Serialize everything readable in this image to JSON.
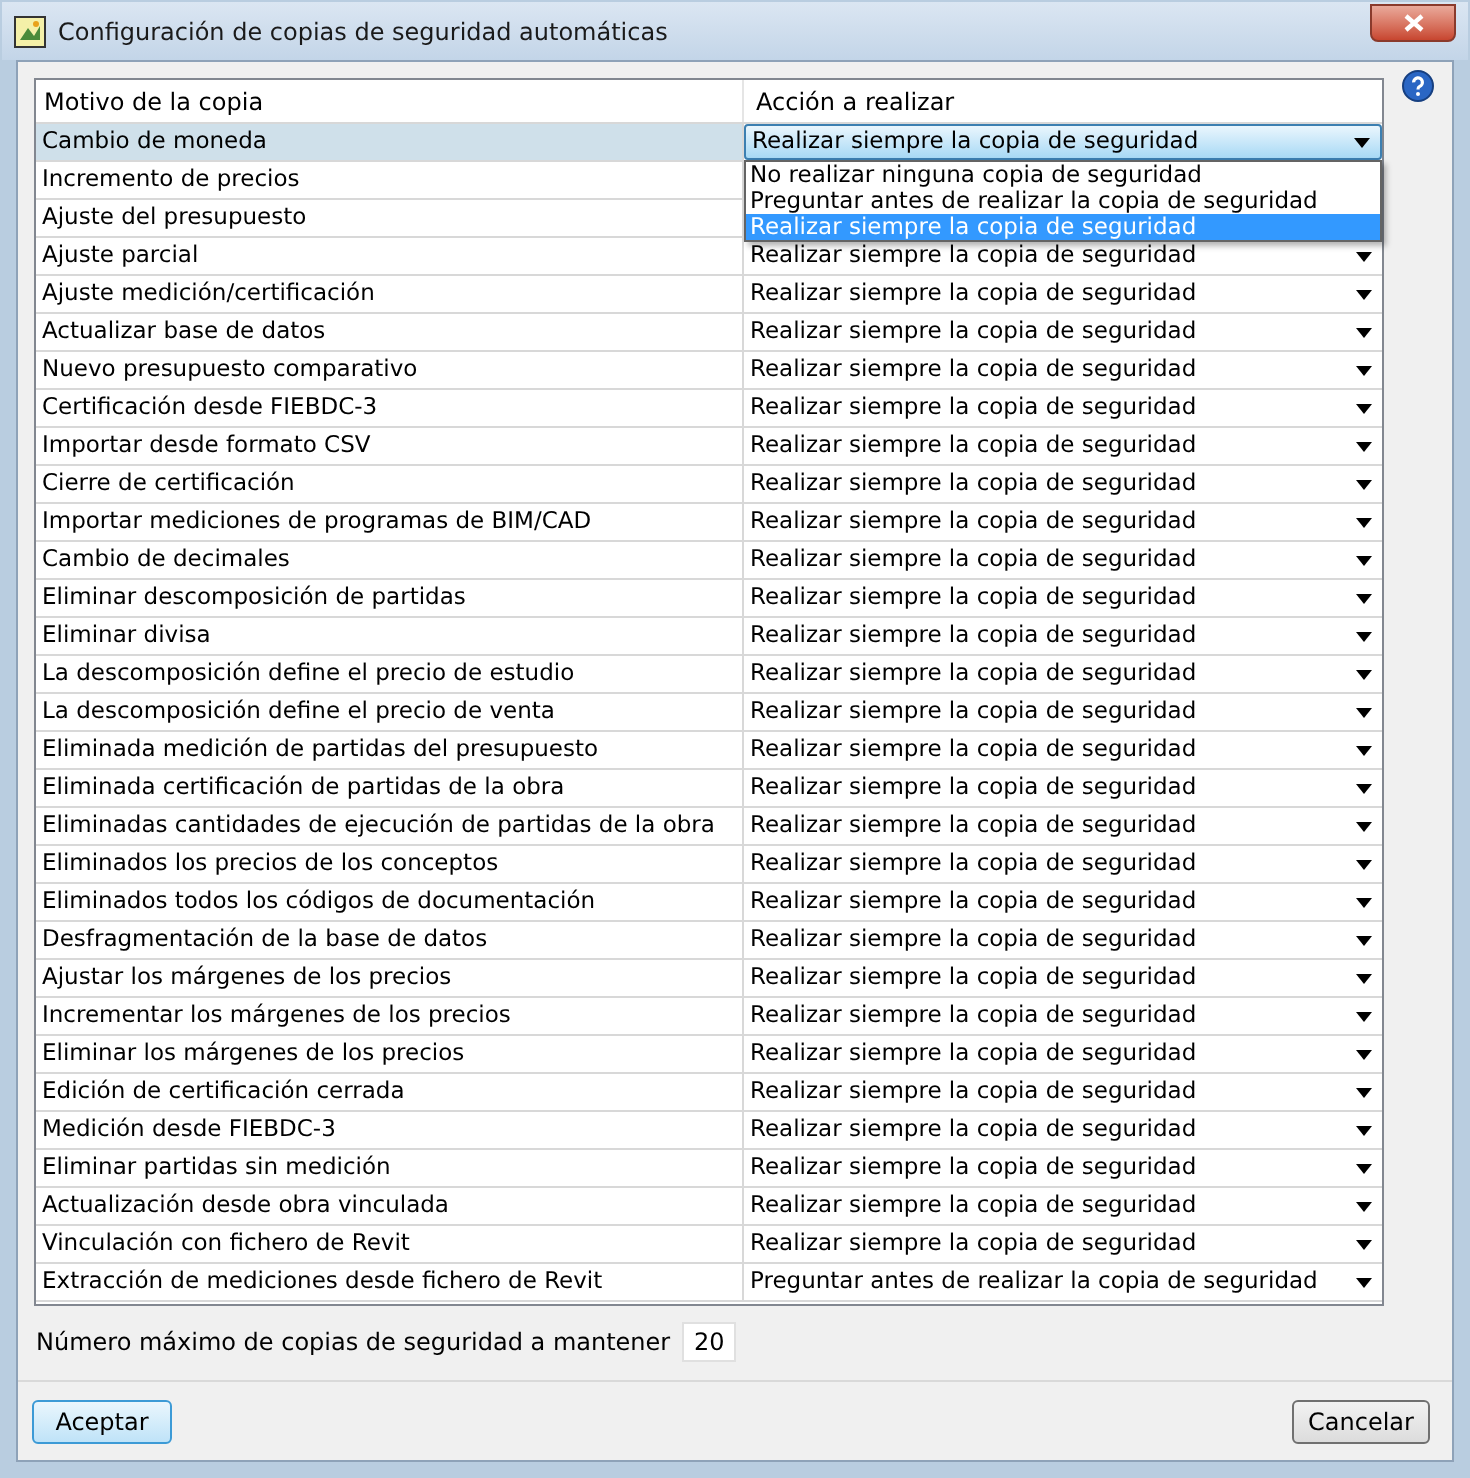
{
  "window": {
    "title": "Configuración de copias de seguridad automáticas"
  },
  "table": {
    "columns": [
      "Motivo de la copia",
      "Acción a realizar"
    ],
    "rows": [
      {
        "motive": "Cambio de moneda",
        "action": "Realizar siempre la copia de seguridad",
        "selected": true,
        "options": [
          {
            "label": "No realizar ninguna copia de seguridad",
            "selected": false
          },
          {
            "label": "Preguntar antes de realizar la copia de seguridad",
            "selected": false
          },
          {
            "label": "Realizar siempre la copia de seguridad",
            "selected": true
          }
        ]
      },
      {
        "motive": "Incremento de precios",
        "selected": false
      },
      {
        "motive": "Ajuste del presupuesto",
        "selected": false
      },
      {
        "motive": "Ajuste parcial",
        "action": "Realizar siempre la copia de seguridad",
        "selected": false
      },
      {
        "motive": "Ajuste medición/certificación",
        "action": "Realizar siempre la copia de seguridad",
        "selected": false
      },
      {
        "motive": "Actualizar base de datos",
        "action": "Realizar siempre la copia de seguridad",
        "selected": false
      },
      {
        "motive": "Nuevo presupuesto comparativo",
        "action": "Realizar siempre la copia de seguridad",
        "selected": false
      },
      {
        "motive": "Certificación desde FIEBDC-3",
        "action": "Realizar siempre la copia de seguridad",
        "selected": false
      },
      {
        "motive": "Importar desde formato CSV",
        "action": "Realizar siempre la copia de seguridad",
        "selected": false
      },
      {
        "motive": "Cierre de certificación",
        "action": "Realizar siempre la copia de seguridad",
        "selected": false
      },
      {
        "motive": "Importar mediciones de programas de BIM/CAD",
        "action": "Realizar siempre la copia de seguridad",
        "selected": false
      },
      {
        "motive": "Cambio de decimales",
        "action": "Realizar siempre la copia de seguridad",
        "selected": false
      },
      {
        "motive": "Eliminar descomposición de partidas",
        "action": "Realizar siempre la copia de seguridad",
        "selected": false
      },
      {
        "motive": "Eliminar divisa",
        "action": "Realizar siempre la copia de seguridad",
        "selected": false
      },
      {
        "motive": "La descomposición define el precio de estudio",
        "action": "Realizar siempre la copia de seguridad",
        "selected": false
      },
      {
        "motive": "La descomposición define el precio de venta",
        "action": "Realizar siempre la copia de seguridad",
        "selected": false
      },
      {
        "motive": "Eliminada medición de partidas del presupuesto",
        "action": "Realizar siempre la copia de seguridad",
        "selected": false
      },
      {
        "motive": "Eliminada certificación de partidas de la obra",
        "action": "Realizar siempre la copia de seguridad",
        "selected": false
      },
      {
        "motive": "Eliminadas cantidades de ejecución de partidas de la obra",
        "action": "Realizar siempre la copia de seguridad",
        "selected": false
      },
      {
        "motive": "Eliminados los precios de los conceptos",
        "action": "Realizar siempre la copia de seguridad",
        "selected": false
      },
      {
        "motive": "Eliminados todos los códigos de documentación",
        "action": "Realizar siempre la copia de seguridad",
        "selected": false
      },
      {
        "motive": "Desfragmentación de la base de datos",
        "action": "Realizar siempre la copia de seguridad",
        "selected": false
      },
      {
        "motive": "Ajustar los márgenes de los precios",
        "action": "Realizar siempre la copia de seguridad",
        "selected": false
      },
      {
        "motive": "Incrementar los márgenes de los precios",
        "action": "Realizar siempre la copia de seguridad",
        "selected": false
      },
      {
        "motive": "Eliminar los márgenes de los precios",
        "action": "Realizar siempre la copia de seguridad",
        "selected": false
      },
      {
        "motive": "Edición de certificación cerrada",
        "action": "Realizar siempre la copia de seguridad",
        "selected": false
      },
      {
        "motive": "Medición desde FIEBDC-3",
        "action": "Realizar siempre la copia de seguridad",
        "selected": false
      },
      {
        "motive": "Eliminar partidas sin medición",
        "action": "Realizar siempre la copia de seguridad",
        "selected": false
      },
      {
        "motive": "Actualización desde obra vinculada",
        "action": "Realizar siempre la copia de seguridad",
        "selected": false
      },
      {
        "motive": "Vinculación con fichero de Revit",
        "action": "Realizar siempre la copia de seguridad",
        "selected": false
      },
      {
        "motive": "Extracción de mediciones desde fichero de Revit",
        "action": "Preguntar antes de realizar la copia de seguridad",
        "selected": false
      }
    ]
  },
  "max_copies": {
    "label": "Número máximo de copias de seguridad a mantener",
    "value": "20"
  },
  "buttons": {
    "accept": "Aceptar",
    "cancel": "Cancelar"
  }
}
